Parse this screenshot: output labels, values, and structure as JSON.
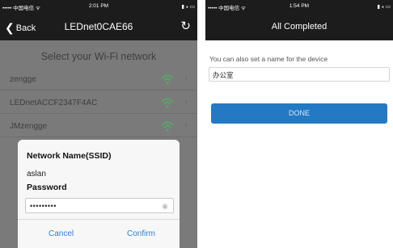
{
  "left_screen": {
    "status_bar": {
      "carrier": "••••• 中国电信 ᯤ",
      "time": "2:01 PM",
      "battery": "▮ ⁎ ▭"
    },
    "nav": {
      "back_label": "Back",
      "title": "LEDnet0CAE66",
      "refresh_icon": "refresh-icon"
    },
    "select_title": "Select your Wi-Fi network",
    "networks": [
      {
        "name": "zengge"
      },
      {
        "name": "LEDnetACCF2347F4AC"
      },
      {
        "name": "JMzengge"
      }
    ],
    "dialog": {
      "ssid_label": "Network Name(SSID)",
      "ssid_value": "aslan",
      "password_label": "Password",
      "password_value": "•••••••••",
      "cancel_label": "Cancel",
      "confirm_label": "Confirm"
    }
  },
  "right_screen": {
    "status_bar": {
      "carrier": "••••• 中国电信 ᯤ",
      "time": "1:54 PM",
      "battery": "▮ ⁎ ▭"
    },
    "nav": {
      "title": "All Completed"
    },
    "hint": "You can also set a name for the device",
    "device_name_value": "办公室",
    "done_label": "DONE"
  },
  "colors": {
    "accent": "#2479c3",
    "link": "#2f7fcf",
    "wifi_signal": "#5aa56a"
  }
}
